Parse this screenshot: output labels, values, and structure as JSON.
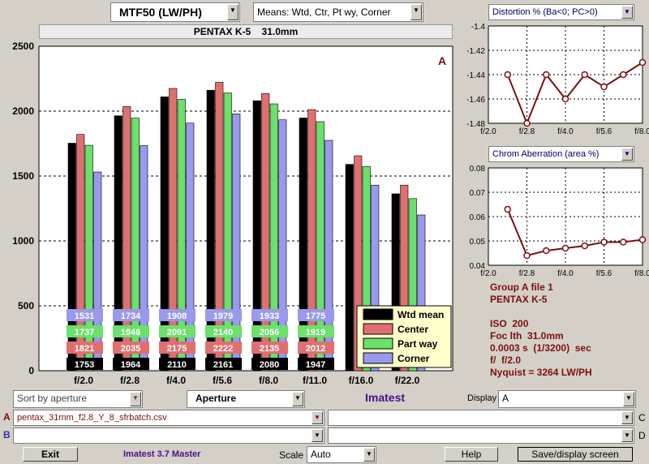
{
  "header": {
    "metric_select": "MTF50 (LW/PH)",
    "means_select": "Means: Wtd, Ctr, Pt wy, Corner",
    "camera_title": "PENTAX K-5    31.0mm"
  },
  "chart_data": [
    {
      "type": "bar",
      "title": "",
      "categories": [
        "f/2.0",
        "f/2.8",
        "f/4.0",
        "f/5.6",
        "f/8.0",
        "f/11.0",
        "f/16.0",
        "f/22.0"
      ],
      "series": [
        {
          "name": "Wtd mean",
          "color": "#000000",
          "values": [
            1753,
            1964,
            2110,
            2161,
            2080,
            1947,
            1590,
            1363
          ]
        },
        {
          "name": "Center",
          "color": "#e07070",
          "values": [
            1821,
            2035,
            2175,
            2222,
            2135,
            2012,
            1656,
            1430
          ]
        },
        {
          "name": "Part way",
          "color": "#6be06b",
          "values": [
            1737,
            1946,
            2091,
            2140,
            2056,
            1919,
            1574,
            1326
          ]
        },
        {
          "name": "Corner",
          "color": "#9999ee",
          "values": [
            1531,
            1734,
            1908,
            1979,
            1933,
            1775,
            1430,
            1200
          ]
        }
      ],
      "labels": [
        [
          "1753",
          "1964",
          "2110",
          "2161",
          "2080",
          "1947"
        ],
        [
          "1821",
          "2035",
          "2175",
          "2222",
          "2135",
          "2012"
        ],
        [
          "1737",
          "1946",
          "2091",
          "2140",
          "2056",
          "1919"
        ],
        [
          "1531",
          "1734",
          "1908",
          "1979",
          "1933",
          "1775"
        ]
      ],
      "yticks": [
        "0",
        "500",
        "1000",
        "1500",
        "2000",
        "2500"
      ],
      "ylim": [
        0,
        2500
      ],
      "corner_label": "A",
      "legend_position": "bottom-right"
    },
    {
      "type": "line",
      "title": "Distortion %  (Ba<0; PC>0)",
      "x": [
        "f/2.0",
        "f/2.8",
        "f/4.0",
        "f/5.6",
        "f/8.0"
      ],
      "values": [
        -1.44,
        -1.48,
        -1.44,
        -1.46,
        -1.44,
        -1.45,
        -1.44,
        -1.43
      ],
      "ylim": [
        -1.48,
        -1.4
      ],
      "yticks": [
        "-1.4",
        "-1.42",
        "-1.44",
        "-1.46",
        "-1.48"
      ]
    },
    {
      "type": "line",
      "title": "Chrom Aberration (area %)",
      "x": [
        "f/2.0",
        "f/2.8",
        "f/4.0",
        "f/5.6",
        "f/8.0"
      ],
      "values": [
        0.063,
        0.044,
        0.046,
        0.047,
        0.048,
        0.0495,
        0.0495,
        0.0505
      ],
      "ylim": [
        0.04,
        0.08
      ],
      "yticks": [
        "0.08",
        "0.07",
        "0.06",
        "0.05",
        "0.04"
      ]
    }
  ],
  "info": {
    "group": "Group A file 1",
    "camera": "PENTAX K-5",
    "iso": "ISO  200",
    "focal": "Foc lth  31.0mm",
    "shutter": "0.0003 s  (1/3200)  sec",
    "fnum": "f/  f/2.0",
    "nyquist": "Nyquist = 3264 LW/PH"
  },
  "controls": {
    "sort": "Sort by aperture",
    "aperture": "Aperture",
    "imatest": "Imatest",
    "display_label": "Display",
    "display_value": "A",
    "row_a": "A",
    "row_b": "B",
    "row_c": "C",
    "row_d": "D",
    "file_a": "pentax_31mm_f2.8_Y_8_sfrbatch.csv",
    "file_b": "",
    "file_c": "",
    "file_d": "",
    "exit": "Exit",
    "version": "Imatest 3.7 Master",
    "scale_label": "Scale",
    "scale_value": "Auto",
    "help": "Help",
    "save": "Save/display screen"
  },
  "colors": {
    "background": "#d4d0c8",
    "accent": "#7a1010",
    "line": "#7a1010"
  }
}
